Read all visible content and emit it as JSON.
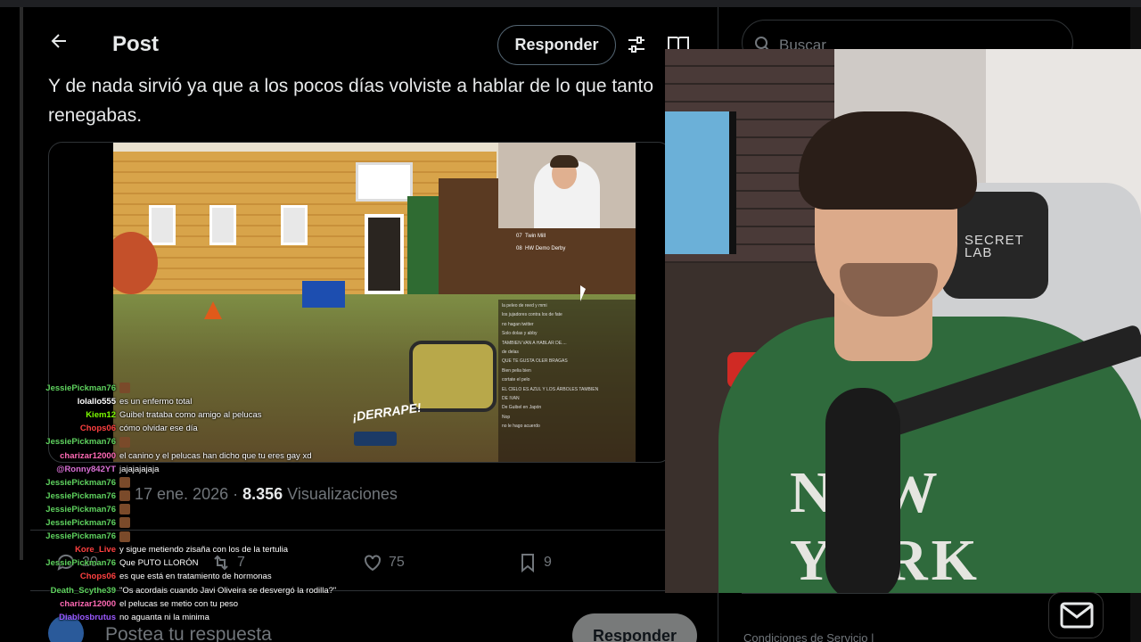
{
  "header": {
    "title": "Post",
    "reply_button": "Responder"
  },
  "tweet": {
    "text": "Y de nada sirvió ya que a los pocos días volviste a hablar de lo que tanto renegabas.",
    "date": "17 ene. 2026",
    "views_count": "8.356",
    "views_label": "Visualizaciones",
    "metrics": {
      "replies": "20",
      "reposts": "7",
      "likes": "75",
      "bookmarks": "9"
    }
  },
  "media": {
    "drift_label": "¡DERRAPE!",
    "leaderboard": [
      {
        "pos": "07",
        "name": "Twin Mill"
      },
      {
        "pos": "08",
        "name": "HW Demo Derby"
      }
    ],
    "mini_chat": [
      "la peleo de reed y mmi",
      "los jujadores contra los de fate",
      "no hagan twitter",
      "Solo dolas y abby",
      "TAMBIEN VAN A HABLAR DE....",
      "de delas",
      "QUE TE GUSTA OLER BRAGAS",
      "Bien pelia bien",
      "cortate el pelo",
      "EL CIELO ES AZUL Y LOS ÁRBOLES TAMBIEN",
      "DE IVAN",
      "De Guibel en Japón",
      "Nop",
      "no le hago acuerdo"
    ]
  },
  "composer": {
    "placeholder": "Postea tu respuesta",
    "reply_button": "Responder"
  },
  "search": {
    "placeholder": "Buscar"
  },
  "footer": {
    "links": "Condiciones de Servicio  |"
  },
  "chair_brand": "SECRET\nLAB",
  "sweater_text": "NEW YORK",
  "twitch_chat": [
    {
      "user": "JessiePickman76",
      "color": "#5fd35f",
      "msg": ""
    },
    {
      "user": "lolallo555",
      "color": "#ffffff",
      "msg": "es un enfermo total"
    },
    {
      "user": "Kiem12",
      "color": "#7cfc00",
      "msg": "Guibel trataba como amigo al pelucas"
    },
    {
      "user": "Chops06",
      "color": "#ff4040",
      "msg": "cómo olvidar ese día"
    },
    {
      "user": "JessiePickman76",
      "color": "#5fd35f",
      "msg": ""
    },
    {
      "user": "charizar12000",
      "color": "#ff69b4",
      "msg": "el canino y el pelucas han dicho que tu eres gay xd"
    },
    {
      "user": "@Ronny842YT",
      "color": "#da70d6",
      "msg": "jajajajajaja"
    },
    {
      "user": "JessiePickman76",
      "color": "#5fd35f",
      "msg": ""
    },
    {
      "user": "JessiePickman76",
      "color": "#5fd35f",
      "msg": ""
    },
    {
      "user": "JessiePickman76",
      "color": "#5fd35f",
      "msg": ""
    },
    {
      "user": "JessiePickman76",
      "color": "#5fd35f",
      "msg": ""
    },
    {
      "user": "JessiePickman76",
      "color": "#5fd35f",
      "msg": ""
    },
    {
      "user": "Kore_Live",
      "color": "#ff4040",
      "msg": "y sigue metiendo zisaña con los de la tertulia"
    },
    {
      "user": "JessiePickman76",
      "color": "#5fd35f",
      "msg": "Que PUTO LLORÓN"
    },
    {
      "user": "Chops06",
      "color": "#ff4040",
      "msg": "es que está en tratamiento de hormonas"
    },
    {
      "user": "Death_Scythe39",
      "color": "#5fd35f",
      "msg": "\"Os acordais cuando Javi Oliveira se desvergó la rodilla?\""
    },
    {
      "user": "charizar12000",
      "color": "#ff69b4",
      "msg": "el pelucas se metio con tu peso"
    },
    {
      "user": "Diablosbrutus",
      "color": "#9b59ff",
      "msg": "no aguanta ni la minima"
    }
  ],
  "colors": {
    "background": "#000000",
    "text_primary": "#e7e9ea",
    "text_secondary": "#71767b",
    "border": "#2f3336",
    "sweater_green": "#2f6a3c"
  }
}
